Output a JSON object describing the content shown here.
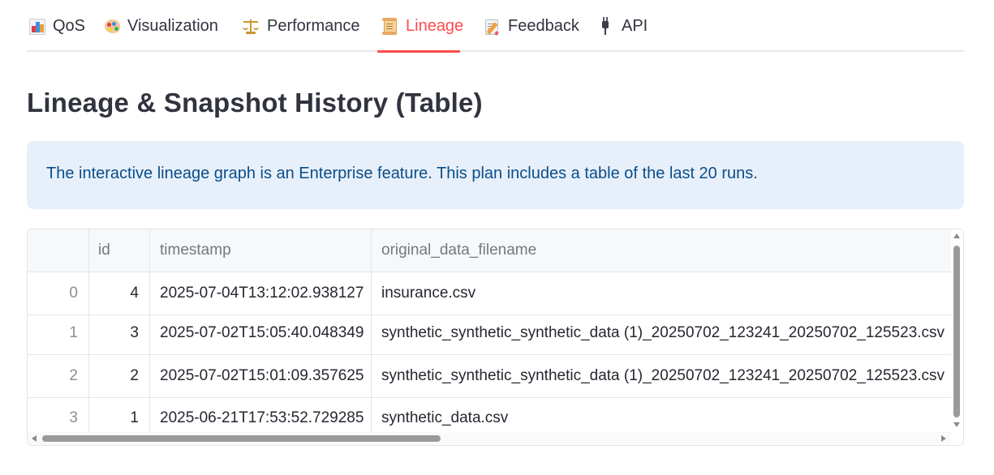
{
  "tabs": [
    {
      "icon": "bar-chart-icon",
      "label": "QoS",
      "active": false
    },
    {
      "icon": "palette-icon",
      "label": "Visualization",
      "active": false
    },
    {
      "icon": "balance-scale-icon",
      "label": "Performance",
      "active": false
    },
    {
      "icon": "scroll-icon",
      "label": "Lineage",
      "active": true
    },
    {
      "icon": "memo-icon",
      "label": "Feedback",
      "active": false
    },
    {
      "icon": "plug-icon",
      "label": "API",
      "active": false
    }
  ],
  "colors": {
    "accent": "#ff4b4b",
    "info_bg": "#e7f0fa",
    "info_text": "#0b4d8a",
    "text": "#31333f"
  },
  "page": {
    "title": "Lineage & Snapshot History (Table)",
    "info": "The interactive lineage graph is an Enterprise feature. This plan includes a table of the last 20 runs."
  },
  "table": {
    "columns": [
      "",
      "id",
      "timestamp",
      "original_data_filename"
    ],
    "rows": [
      {
        "index": "0",
        "id": "4",
        "timestamp": "2025-07-04T13:12:02.938127",
        "filename": "insurance.csv"
      },
      {
        "index": "1",
        "id": "3",
        "timestamp": "2025-07-02T15:05:40.048349",
        "filename": "synthetic_synthetic_synthetic_data (1)_20250702_123241_20250702_125523.csv"
      },
      {
        "index": "2",
        "id": "2",
        "timestamp": "2025-07-02T15:01:09.357625",
        "filename": "synthetic_synthetic_synthetic_data (1)_20250702_123241_20250702_125523.csv"
      },
      {
        "index": "3",
        "id": "1",
        "timestamp": "2025-06-21T17:53:52.729285",
        "filename": "synthetic_data.csv"
      }
    ]
  }
}
